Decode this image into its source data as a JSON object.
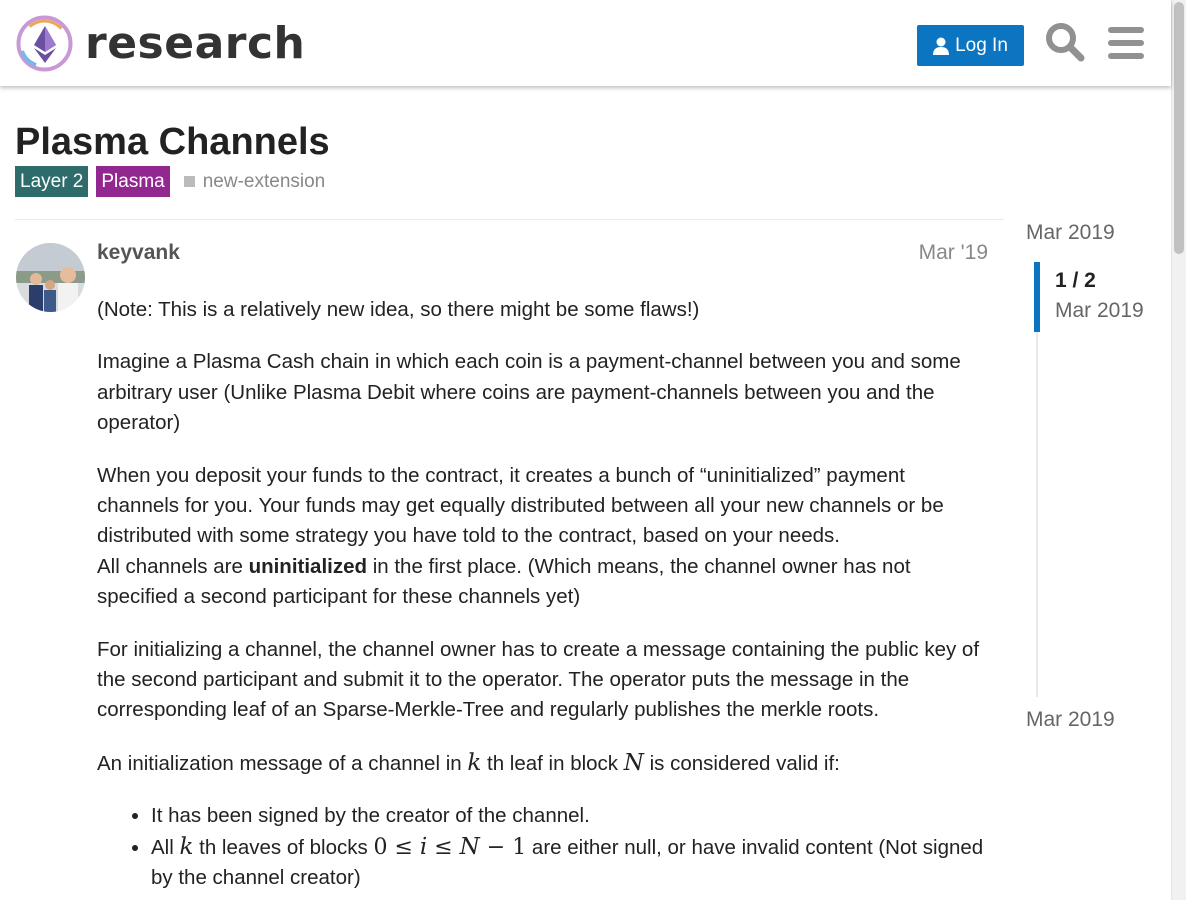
{
  "header": {
    "site_name": "research",
    "login_label": "Log In",
    "icons": [
      "user-icon",
      "search-icon",
      "hamburger-menu-icon"
    ]
  },
  "topic": {
    "title": "Plasma Channels",
    "categories": [
      {
        "label": "Layer 2",
        "color": "#2e6b6b"
      },
      {
        "label": "Plasma",
        "color": "#92278f"
      }
    ],
    "tags": [
      "new-extension"
    ]
  },
  "post": {
    "author": "keyvank",
    "date": "Mar '19",
    "p1": "(Note: This is a relatively new idea, so there might be some flaws!)",
    "p2": "Imagine a Plasma Cash chain in which each coin is a payment-channel between you and some arbitrary user (Unlike Plasma Debit where coins are payment-channels between you and the operator)",
    "p3a": "When you deposit your funds to the contract, it creates a bunch of “uninitialized” payment channels for you. Your funds may get equally distributed between all your new channels or be distributed with some strategy you have told to the contract, based on your needs.",
    "p3b_pre": "All channels are ",
    "p3b_bold": "uninitialized",
    "p3b_post": " in the first place. (Which means, the channel owner has not specified a second participant for these channels yet)",
    "p4": "For initializing a channel, the channel owner has to create a message containing the public key of the second participant and submit it to the operator. The operator puts the message in the corresponding leaf of an Sparse-Merkle-Tree and regularly publishes the merkle roots.",
    "p5_a": "An initialization message of a channel in ",
    "p5_k": "k",
    "p5_b": " th leaf in block ",
    "p5_N": "N",
    "p5_c": " is considered valid if:",
    "li1": "It has been signed by the creator of the channel.",
    "li2_a": "All ",
    "li2_k": "k",
    "li2_b": " th leaves of blocks ",
    "li2_zero": "0 ≤ ",
    "li2_i": "i",
    "li2_le": " ≤ ",
    "li2_N": "N",
    "li2_minus": " − 1",
    "li2_c": " are either null, or have invalid content (Not signed by the channel creator)"
  },
  "timeline": {
    "start": "Mar 2019",
    "position": "1 / 2",
    "position_date": "Mar 2019",
    "end": "Mar 2019"
  },
  "colors": {
    "accent": "#0c75c1"
  }
}
